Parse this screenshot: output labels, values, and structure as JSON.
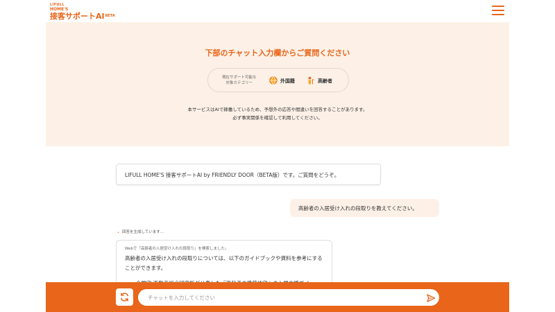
{
  "header": {
    "logo_small": "LIFULL",
    "logo_brand": "HOME'S",
    "logo_title": "接客サポートAI",
    "logo_beta": "BETA",
    "menu_icon": "hamburger-menu-icon"
  },
  "hero": {
    "title": "下部のチャット入力欄からご質問ください",
    "category_label_line1": "現在サポート可能な",
    "category_label_line2": "対象カテゴリー",
    "categories": [
      {
        "label": "外国籍",
        "icon": "globe-icon"
      },
      {
        "label": "高齢者",
        "icon": "elderly-person-icon"
      }
    ],
    "note_line1": "本サービスはAIで稼働しているため、予想外の応答や間違いを回答することがあります。",
    "note_line2": "必ず事実関係を確認して利用してください。"
  },
  "chat": {
    "bot_greeting": "LIFULL HOME'S 接客サポートAI by FRIENDLY DOOR（BETA版）です。ご質問をどうぞ。",
    "user_message": "高齢者の入居受け入れの段取りを教えてください。",
    "generating_status": "回答を生成しています...",
    "answer_search_note": "Webで「高齢者の入居受け入れの段取り」を検索しました。",
    "answer_text": "高齢者の入居受け入れの段取りについては、以下のガイドブックや資料を参考にすることができます。",
    "answer_cut_line": "・ 全国宅 不動産総合研究所が公表した『高齢者の賃貸住宅への入居支援ガイ"
  },
  "input": {
    "placeholder": "チャットを入力してください",
    "refresh_icon": "refresh-icon",
    "send_icon": "send-icon"
  },
  "colors": {
    "accent": "#e8651a",
    "hero_bg": "#fdf1e7"
  }
}
